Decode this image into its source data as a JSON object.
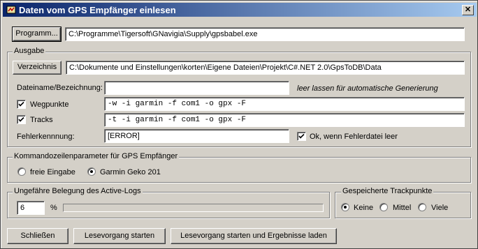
{
  "window": {
    "title": "Daten vom GPS Empfänger einlesen",
    "close_glyph": "✕",
    "icon": "gps-app-icon"
  },
  "program": {
    "button_label": "Programm...",
    "path": "C:\\Programme\\Tigersoft\\GNavigia\\Supply\\gpsbabel.exe"
  },
  "output": {
    "group_title": "Ausgabe",
    "dir_button_label": "Verzeichnis",
    "dir_path": "C:\\Dokumente und Einstellungen\\korten\\Eigene Dateien\\Projekt\\C#.NET 2.0\\GpsToDB\\Data",
    "filename_label": "Dateiname/Bezeichnung:",
    "filename_value": "",
    "filename_hint": "leer lassen für automatische Generierung",
    "waypoints_label": "Wegpunkte",
    "waypoints_checked": true,
    "waypoints_args": "-w -i garmin -f com1 -o gpx -F",
    "tracks_label": "Tracks",
    "tracks_checked": true,
    "tracks_args": "-t -i garmin -f com1 -o gpx -F",
    "error_label": "Fehlerkennnung:",
    "error_value": "[ERROR]",
    "ok_label": "Ok, wenn Fehlerdatei leer",
    "ok_checked": true
  },
  "cmdline": {
    "group_title": "Kommandozeilenparameter für GPS Empfänger",
    "options": [
      "freie Eingabe",
      "Garmin Geko 201"
    ],
    "selected": "Garmin Geko 201"
  },
  "activelog": {
    "group_title": "Ungefähre Belegung des Active-Logs",
    "value": "6",
    "unit": "%",
    "fill_fraction": 0.0
  },
  "trackpoints": {
    "group_title": "Gespeicherte Trackpunkte",
    "options": [
      "Keine",
      "Mittel",
      "Viele"
    ],
    "selected": "Keine"
  },
  "buttons": {
    "close": "Schließen",
    "read": "Lesevorgang starten",
    "read_load": "Lesevorgang starten und Ergebnisse laden"
  },
  "colors": {
    "title_start": "#0a246a",
    "title_end": "#a6caf0",
    "face": "#d4d0c8"
  }
}
